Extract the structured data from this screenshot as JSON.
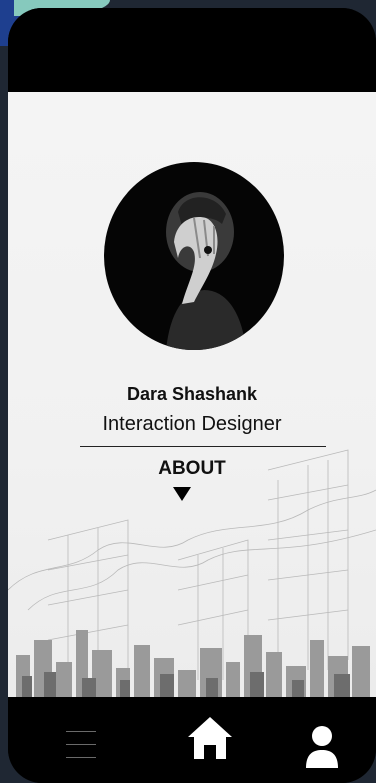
{
  "profile": {
    "name": "Dara Shashank",
    "role": "Interaction Designer",
    "photo_icon": "portrait-photo"
  },
  "about": {
    "label": "ABOUT",
    "arrow_icon": "triangle-down-icon"
  },
  "bottom_nav": {
    "items": [
      {
        "id": "menu",
        "icon": "hamburger-icon"
      },
      {
        "id": "home",
        "icon": "home-icon"
      },
      {
        "id": "profile",
        "icon": "user-icon"
      }
    ]
  },
  "colors": {
    "bars": "#000000",
    "screen_background": "#f2f2f2",
    "text": "#111111",
    "icon": "#ffffff"
  }
}
